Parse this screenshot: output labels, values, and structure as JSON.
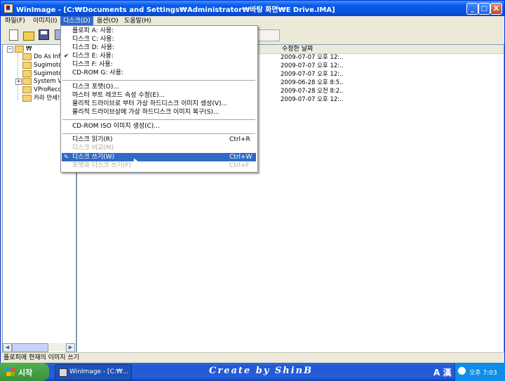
{
  "window": {
    "title": "WinImage - [C:₩Documents and Settings₩Administrator₩바탕 화면₩E Drive.IMA]",
    "controls": {
      "minimize": "_",
      "maximize": "□",
      "close": "X"
    }
  },
  "menubar": {
    "items": [
      {
        "label": "파일(F)",
        "active": false
      },
      {
        "label": "이미지(I)",
        "active": false
      },
      {
        "label": "디스크(D)",
        "active": true
      },
      {
        "label": "옵션(O)",
        "active": false
      },
      {
        "label": "도움말(H)",
        "active": false
      }
    ]
  },
  "toolbar": {
    "buttons": [
      "new-icon",
      "open-icon",
      "save-icon",
      "tool-icon"
    ]
  },
  "tree": {
    "root": "₩",
    "nodes": [
      {
        "label": "Do As Infi",
        "expandable": false
      },
      {
        "label": "Sugimoto",
        "expandable": false
      },
      {
        "label": "Sugimoto",
        "expandable": false
      },
      {
        "label": "System V",
        "expandable": true
      },
      {
        "label": "VProReco",
        "expandable": false
      },
      {
        "label": "카라 만세!",
        "expandable": false
      }
    ]
  },
  "list": {
    "header_modified": "수정한 날짜",
    "rows": [
      "2009-07-07  오후 12:..",
      "2009-07-07  오후 12:..",
      "2009-07-07  오후 12:..",
      "2009-06-28  오후 8:5..",
      "2009-07-28  오전 8:2..",
      "2009-07-07  오후 12:.."
    ]
  },
  "dropdown": {
    "group1": [
      {
        "label": "플로피 A: 사용:",
        "checked": false
      },
      {
        "label": "디스크 C: 사용:",
        "checked": false
      },
      {
        "label": "디스크 D: 사용:",
        "checked": false
      },
      {
        "label": "디스크 E: 사용:",
        "checked": true
      },
      {
        "label": "디스크 F: 사용:",
        "checked": false
      },
      {
        "label": "CD-ROM G: 사용:",
        "checked": false
      }
    ],
    "group2": [
      {
        "label": "디스크 포맷(O)..."
      },
      {
        "label": "마스터 부트 레코드 속성 수정(E)..."
      },
      {
        "label": "물리적 드라이브로 부터 가상 하드디스크 이미지 생성(V)..."
      },
      {
        "label": "물리적 드라이브상에 가상 하드디스크 이미지 복구(S)..."
      }
    ],
    "group3": [
      {
        "label": "CD-ROM ISO 이미지 생성(C)..."
      }
    ],
    "group4": [
      {
        "label": "디스크 읽기(R)",
        "shortcut": "Ctrl+R",
        "disabled": false,
        "highlighted": false
      },
      {
        "label": "디스크 비교(M)",
        "shortcut": "",
        "disabled": true,
        "highlighted": false
      },
      {
        "label": "디스크 쓰기(W)",
        "shortcut": "Ctrl+W",
        "disabled": false,
        "highlighted": true
      },
      {
        "label": "포맷과 디스크 쓰기(F)",
        "shortcut": "Ctrl+F",
        "disabled": true,
        "highlighted": false
      }
    ]
  },
  "statusbar": {
    "text": "플로피에 현재의 이미지 쓰기"
  },
  "taskbar": {
    "start_label": "시작",
    "task_label": "WinImage - [C:₩...",
    "brand_text": "Create by ShinB",
    "ime_text": "A 漢",
    "clock": "오후 7:03"
  }
}
